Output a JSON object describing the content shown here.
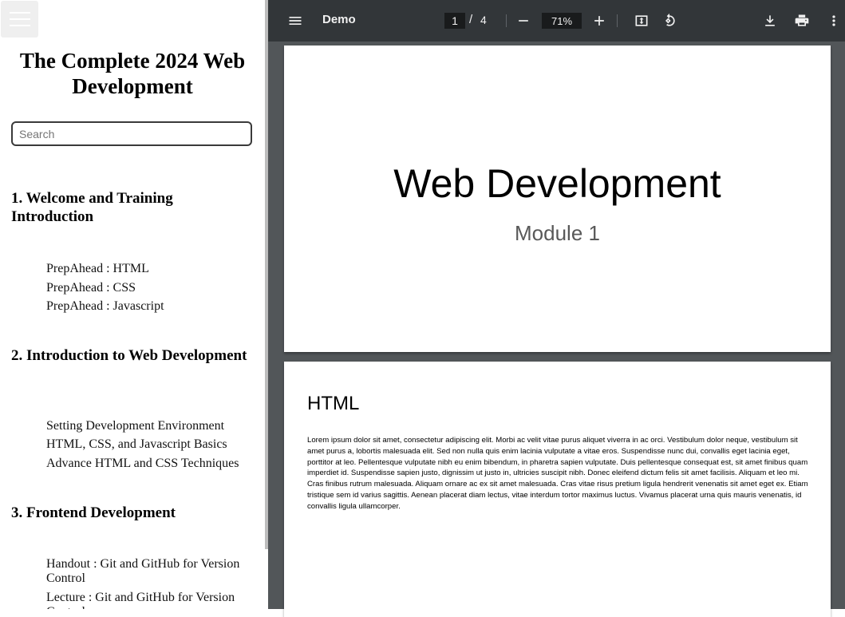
{
  "sidebar": {
    "title": "The Complete 2024 Web Development",
    "search_placeholder": "Search",
    "sections": [
      {
        "title": "1. Welcome and Training Introduction",
        "lessons": [
          "PrepAhead : HTML",
          "PrepAhead : CSS",
          "PrepAhead : Javascript"
        ]
      },
      {
        "title": "2. Introduction to Web Development",
        "lessons": [
          "Setting Development Environment",
          "HTML, CSS, and Javascript Basics",
          "Advance HTML and CSS Techniques"
        ]
      },
      {
        "title": "3. Frontend Development",
        "lessons": [
          "Handout : Git and GitHub for Version Control",
          "Lecture : Git and GitHub for Version Control"
        ]
      }
    ]
  },
  "viewer": {
    "doc_title": "Demo",
    "current_page": "1",
    "separator": "/",
    "total_pages": "4",
    "zoom": "71%",
    "icons": {
      "menu": "menu-icon",
      "zoom_out": "minus-icon",
      "zoom_in": "plus-icon",
      "fit": "fit-page-icon",
      "rotate": "rotate-icon",
      "download": "download-icon",
      "print": "print-icon",
      "more": "more-vert-icon"
    },
    "pages": [
      {
        "title": "Web Development",
        "subtitle": "Module 1"
      },
      {
        "heading": "HTML",
        "body": "Lorem ipsum dolor sit amet, consectetur adipiscing elit. Morbi ac velit vitae purus aliquet viverra in ac orci. Vestibulum dolor neque, vestibulum sit amet purus a, lobortis malesuada elit. Sed non nulla quis enim lacinia vulputate a vitae eros. Suspendisse nunc dui, convallis eget lacinia eget, porttitor at leo. Pellentesque vulputate nibh eu enim bibendum, in pharetra sapien vulputate. Duis pellentesque consequat est, sit amet finibus quam imperdiet id. Suspendisse sapien justo, dignissim ut justo in, ultricies suscipit nibh. Donec eleifend dictum felis sit amet facilisis. Aliquam et leo mi. Cras finibus rutrum malesuada. Aliquam ornare ac ex sit amet malesuada. Cras vitae risus pretium ligula hendrerit venenatis sit amet eget ex. Etiam tristique sem id varius sagittis. Aenean placerat diam lectus, vitae interdum tortor maximus luctus. Vivamus placerat urna quis mauris venenatis, id convallis ligula ullamcorper."
      }
    ]
  },
  "colors": {
    "toolbar_bg": "#323639",
    "viewer_bg": "#525659",
    "sidebar_bg": "#ffffff"
  }
}
